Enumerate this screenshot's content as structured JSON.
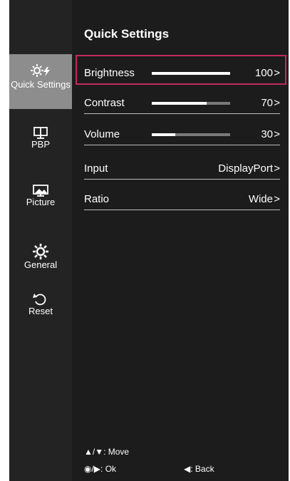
{
  "colors": {
    "accent": "#c12a5a",
    "bar_track": "#7a7a7a",
    "bar_fill": "#ffffff",
    "active_bg": "#8d8d8d"
  },
  "sidebar": {
    "items": [
      {
        "label": "Quick Settings",
        "icon": "quick-settings-icon",
        "active": true
      },
      {
        "label": "PBP",
        "icon": "pbp-icon",
        "active": false
      },
      {
        "label": "Picture",
        "icon": "picture-icon",
        "active": false
      },
      {
        "label": "General",
        "icon": "gear-icon",
        "active": false
      },
      {
        "label": "Reset",
        "icon": "reset-icon",
        "active": false
      }
    ]
  },
  "main": {
    "title": "Quick Settings",
    "rows": [
      {
        "label": "Brightness",
        "value": "100",
        "level": 100,
        "selected": true
      },
      {
        "label": "Contrast",
        "value": "70",
        "level": 70
      },
      {
        "label": "Volume",
        "value": "30",
        "level": 30
      },
      {
        "label": "Input",
        "value": "DisplayPort"
      },
      {
        "label": "Ratio",
        "value": "Wide"
      }
    ],
    "chevron": ">"
  },
  "footer": {
    "move_keys": "▲/▼",
    "move": ": Move",
    "ok_keys": "◉/▶",
    "ok": ": Ok",
    "back_key": "◀",
    "back": ": Back"
  }
}
